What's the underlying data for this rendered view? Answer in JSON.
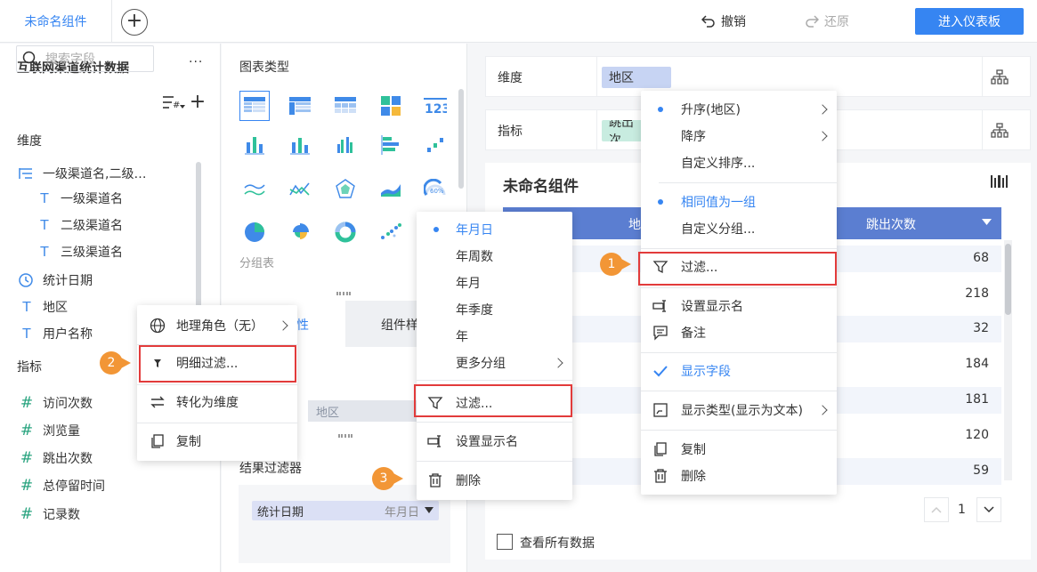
{
  "topbar": {
    "tab_name": "未命名组件",
    "undo": "撤销",
    "redo": "还原",
    "enter_dashboard": "进入仪表板"
  },
  "left": {
    "dataset": "互联网渠道统计数据",
    "more": "···",
    "search_placeholder": "搜索字段",
    "dim_section": "维度",
    "dims": [
      {
        "label": "一级渠道名,二级…"
      },
      {
        "label": "一级渠道名"
      },
      {
        "label": "二级渠道名"
      },
      {
        "label": "三级渠道名"
      },
      {
        "label": "统计日期"
      },
      {
        "label": "地区"
      },
      {
        "label": "用户名称"
      }
    ],
    "metric_section": "指标",
    "metrics": [
      {
        "label": "访问次数"
      },
      {
        "label": "浏览量"
      },
      {
        "label": "跳出次数"
      },
      {
        "label": "总停留时间"
      },
      {
        "label": "记录数"
      }
    ]
  },
  "middle": {
    "chart_type_title": "图表类型",
    "group_table_label": "分组表",
    "tab_attr": "性",
    "tab_comp": "组件样",
    "dim_chip": "地区",
    "result_filter_title": "结果过滤器",
    "result_filter_field": "统计日期",
    "result_filter_group": "年月日"
  },
  "config": {
    "dim_label": "维度",
    "dim_chip": "地区",
    "metric_label": "指标",
    "metric_chip": "跳出次"
  },
  "widget": {
    "title": "未命名组件",
    "col1": "地",
    "col2": "跳出次数",
    "values": [
      "68",
      "218",
      "32",
      "184",
      "181",
      "120",
      "59"
    ],
    "page": "1",
    "show_all": "查看所有数据"
  },
  "menu_field": {
    "items": [
      "地理角色（无）",
      "明细过滤...",
      "转化为维度",
      "复制"
    ]
  },
  "menu_date": {
    "items": [
      "年月日",
      "年周数",
      "年月",
      "年季度",
      "年",
      "更多分组",
      "过滤...",
      "设置显示名",
      "删除"
    ]
  },
  "menu_dim": {
    "items": [
      "升序(地区)",
      "降序",
      "自定义排序...",
      "相同值为一组",
      "自定义分组...",
      "过滤...",
      "设置显示名",
      "备注",
      "显示字段",
      "显示类型(显示为文本)",
      "复制",
      "删除"
    ]
  },
  "badges": [
    "1",
    "2",
    "3"
  ],
  "colors": {
    "accent": "#3685f2",
    "highlight": "#e23b3b",
    "badge": "#f29636",
    "table_header": "#5b7ed1"
  }
}
